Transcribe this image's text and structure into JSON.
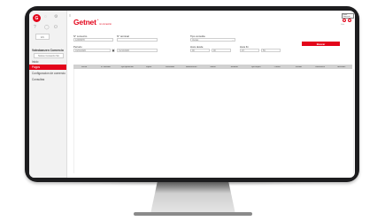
{
  "sidebar": {
    "user_badge": "G",
    "language": "ES",
    "company_name": "Votrobanzen Comercio",
    "company_select": "Notrex Comercio SA",
    "nav": [
      {
        "label": "Inicio",
        "active": false
      },
      {
        "label": "Pagos",
        "active": true
      },
      {
        "label": "Configuracion de comercio",
        "active": false
      },
      {
        "label": "Consultas",
        "active": false
      }
    ]
  },
  "header": {
    "brand": "Getnet",
    "brand_sup": "+",
    "brand_sub": "mi comercio",
    "portal_button": "Portal Comercio",
    "small_text": "Salir"
  },
  "filters": {
    "comercio": {
      "label": "N° comercio",
      "placeholder": "12345678"
    },
    "terminal": {
      "label": "N° terminal",
      "placeholder": ""
    },
    "tipo_consulta": {
      "label": "Tipo consulta",
      "value": "Ventas"
    },
    "periodo": {
      "label": "Periodo",
      "from": "01/01/2020",
      "to": "31/12/2020"
    },
    "hora_desde": {
      "label": "Hora desde",
      "hh": "00",
      "mm": "00"
    },
    "hora_fin": {
      "label": "Hora fin",
      "hh": "23",
      "mm": "59"
    },
    "search_button": "Buscar"
  },
  "table": {
    "columns": [
      "Fecha",
      "N° terminal",
      "Tipo operacion",
      "Tarjeta",
      "Resultado",
      "Autorizacion",
      "Monto",
      "Moneda",
      "Tipo tarjeta",
      "Cuotas",
      "Estado",
      "Referencia",
      "Acciones"
    ]
  },
  "colors": {
    "accent": "#e3051b",
    "bezel": "#1d1d1f",
    "table_header": "#d1d1d1"
  }
}
